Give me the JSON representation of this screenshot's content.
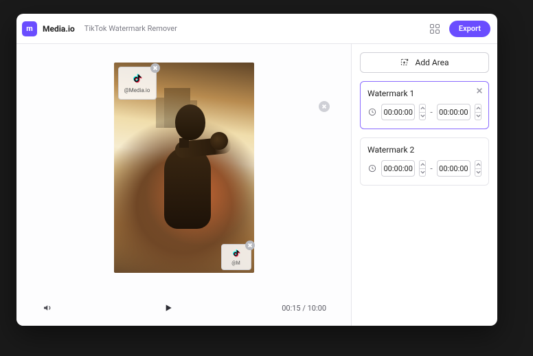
{
  "header": {
    "logo_text": "m",
    "brand": "Media.io",
    "page_title": "TikTok Watermark Remover",
    "export_label": "Export"
  },
  "toolbar": {
    "add_area_label": "Add Area"
  },
  "player": {
    "time_text": "00:15 / 10:00"
  },
  "selections": {
    "caption1": "@Media.io",
    "caption2": "@M"
  },
  "watermarks": [
    {
      "title": "Watermark 1",
      "start": "00:00:00",
      "end": "00:00:00",
      "active": true
    },
    {
      "title": "Watermark 2",
      "start": "00:00:00",
      "end": "00:00:00",
      "active": false
    }
  ]
}
